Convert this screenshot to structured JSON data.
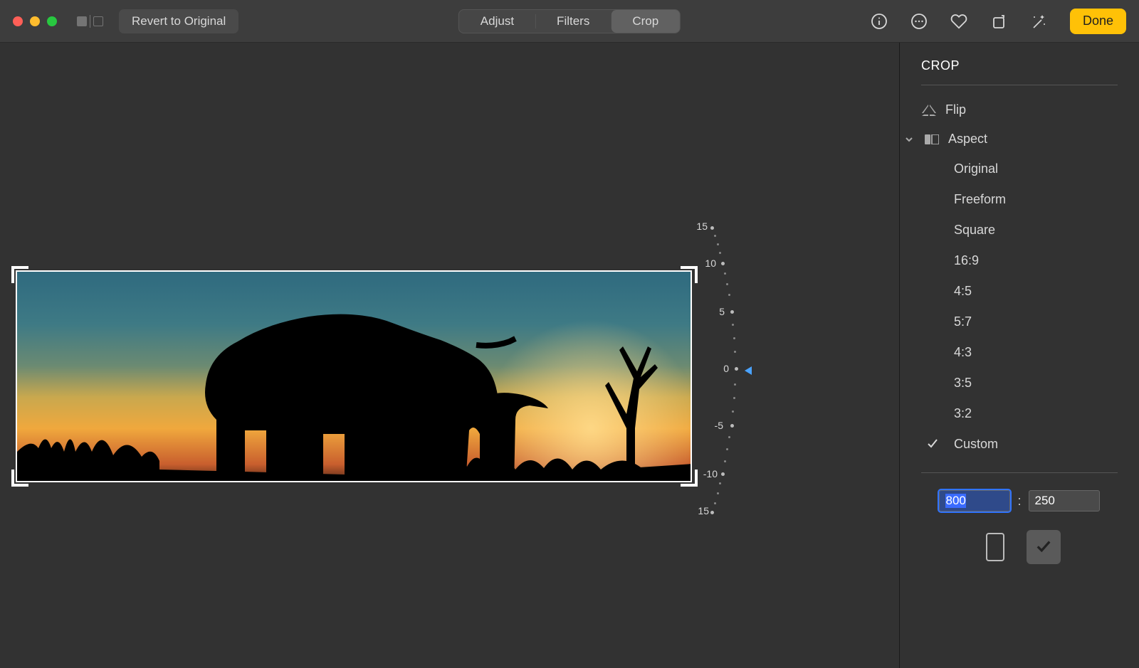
{
  "toolbar": {
    "revert_label": "Revert to Original",
    "tabs": [
      "Adjust",
      "Filters",
      "Crop"
    ],
    "active_tab": "Crop",
    "done_label": "Done"
  },
  "dial": {
    "labels": {
      "n15": "15",
      "n10": "-10",
      "n5": "-5",
      "zero": "0",
      "p5": "5",
      "p10": "10",
      "p15": "15"
    },
    "current_value": 0
  },
  "sidebar": {
    "title": "CROP",
    "flip_label": "Flip",
    "aspect_label": "Aspect",
    "aspect_options": [
      "Original",
      "Freeform",
      "Square",
      "16:9",
      "4:5",
      "5:7",
      "4:3",
      "3:5",
      "3:2",
      "Custom"
    ],
    "selected_aspect": "Custom",
    "ratio_width": "800",
    "ratio_height": "250",
    "ratio_separator": ":"
  }
}
